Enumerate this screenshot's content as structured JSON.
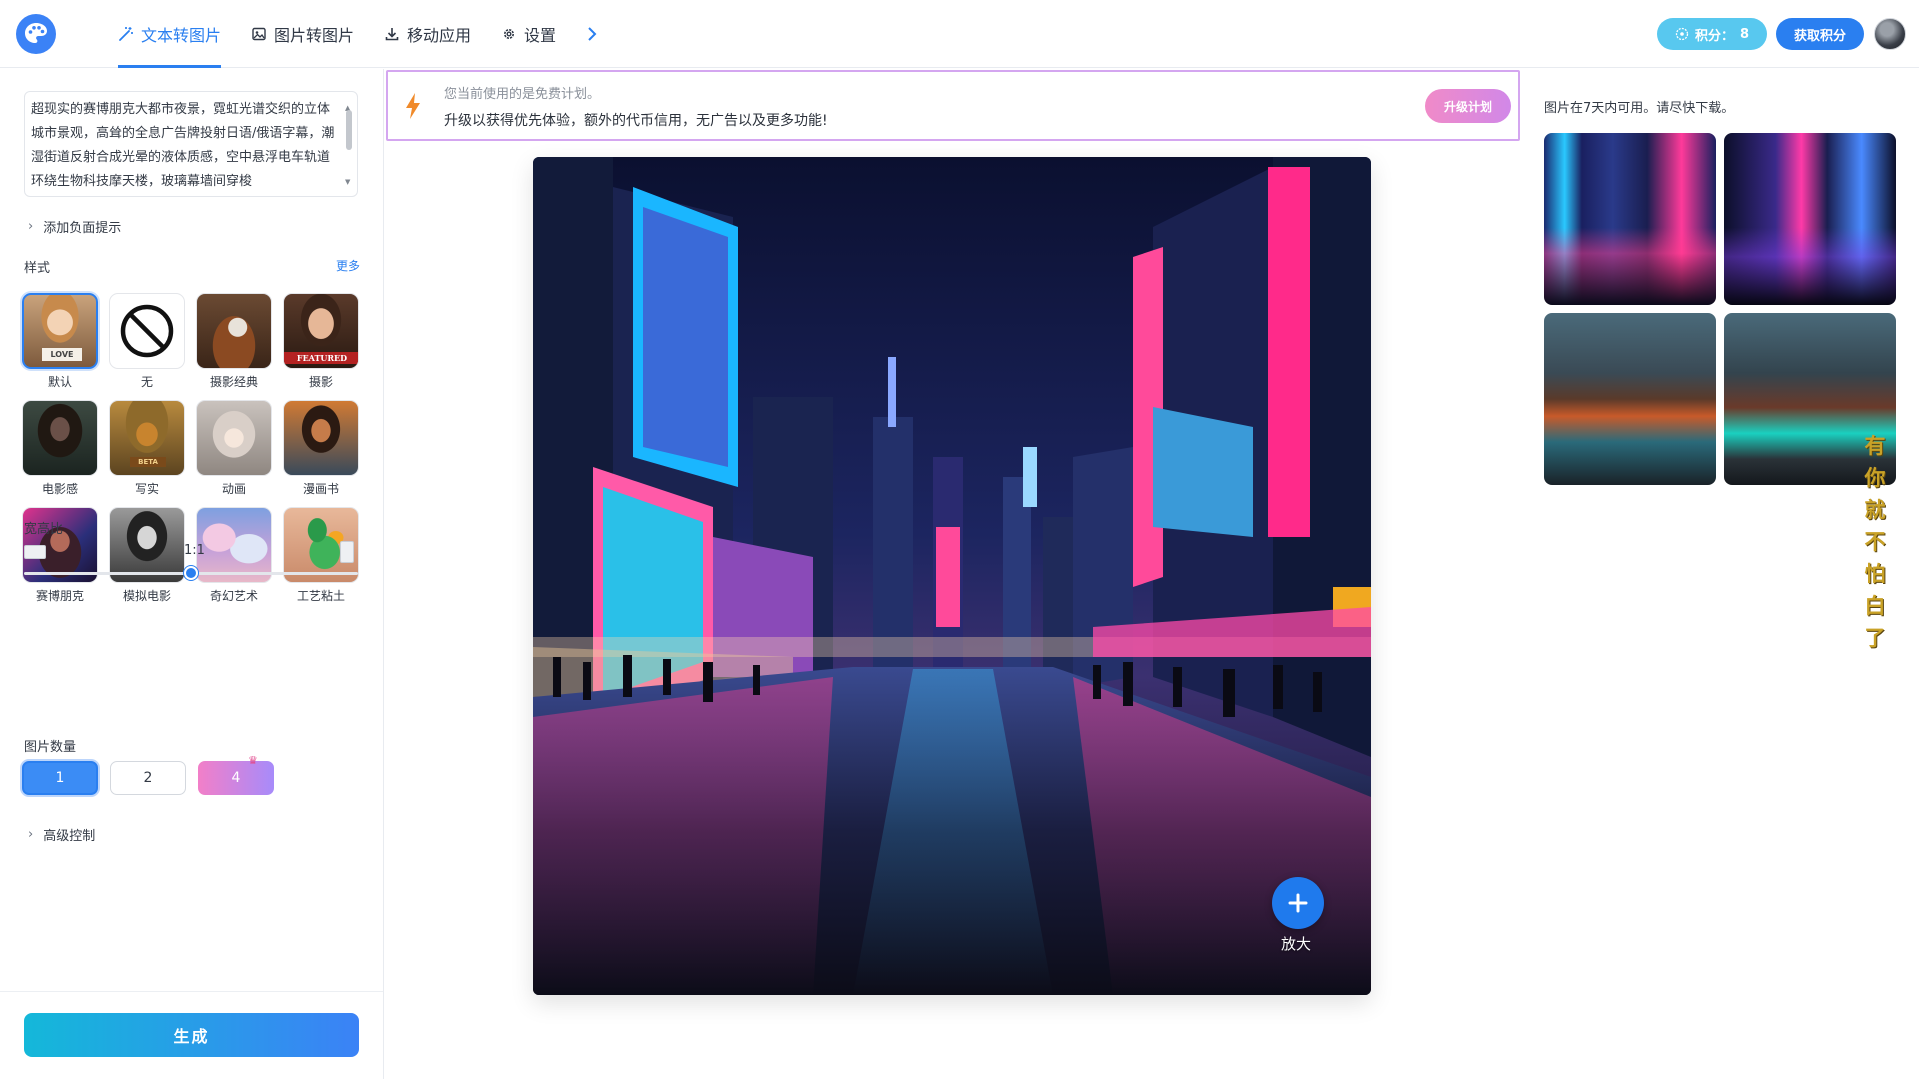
{
  "nav": {
    "items": [
      {
        "label": "文本转图片",
        "icon": "magic-wand-icon",
        "active": true
      },
      {
        "label": "图片转图片",
        "icon": "image-icon",
        "active": false
      },
      {
        "label": "移动应用",
        "icon": "download-icon",
        "active": false
      },
      {
        "label": "设置",
        "icon": "gear-icon",
        "active": false
      }
    ]
  },
  "account": {
    "points_label": "积分：",
    "points_value": "8",
    "get_points_label": "获取积分"
  },
  "left": {
    "prompt_text": "超现实的赛博朋克大都市夜景，霓虹光谱交织的立体城市景观，高耸的全息广告牌投射日语/俄语字幕，潮湿街道反射合成光晕的液体质感，空中悬浮电车轨道环绕生物科技摩天楼，玻璃幕墙间穿梭",
    "negative_prompt_label": "添加负面提示",
    "styles_title": "样式",
    "more_label": "更多",
    "styles": [
      {
        "label": "默认",
        "selected": true
      },
      {
        "label": "无",
        "selected": false
      },
      {
        "label": "摄影经典",
        "selected": false
      },
      {
        "label": "摄影",
        "selected": false
      },
      {
        "label": "电影感",
        "selected": false
      },
      {
        "label": "写实",
        "selected": false
      },
      {
        "label": "动画",
        "selected": false
      },
      {
        "label": "漫画书",
        "selected": false
      },
      {
        "label": "赛博朋克",
        "selected": false
      },
      {
        "label": "模拟电影",
        "selected": false
      },
      {
        "label": "奇幻艺术",
        "selected": false
      },
      {
        "label": "工艺粘土",
        "selected": false
      }
    ],
    "style_badges": {
      "love": "LOVE",
      "featured": "FEATURED",
      "beta": "BETA"
    },
    "aspect_title": "宽高比",
    "aspect_value": "1:1",
    "aspect_slider_position": 0.5,
    "count_title": "图片数量",
    "counts": [
      "1",
      "2",
      "4"
    ],
    "selected_count": "1",
    "advanced_label": "高级控制",
    "generate_label": "生成"
  },
  "center": {
    "promo_line1": "您当前使用的是免费计划。",
    "promo_line2": "升级以获得优先体验，额外的代币信用，无广告以及更多功能!",
    "upgrade_label": "升级计划",
    "zoom_label": "放大"
  },
  "right": {
    "note": "图片在7天内可用。请尽快下载。",
    "side_text": "有你就不怕白了"
  },
  "colors": {
    "accent": "#2a7ff0",
    "points_bg": "#58c8ef",
    "promo_border": "#d4a6f0"
  }
}
